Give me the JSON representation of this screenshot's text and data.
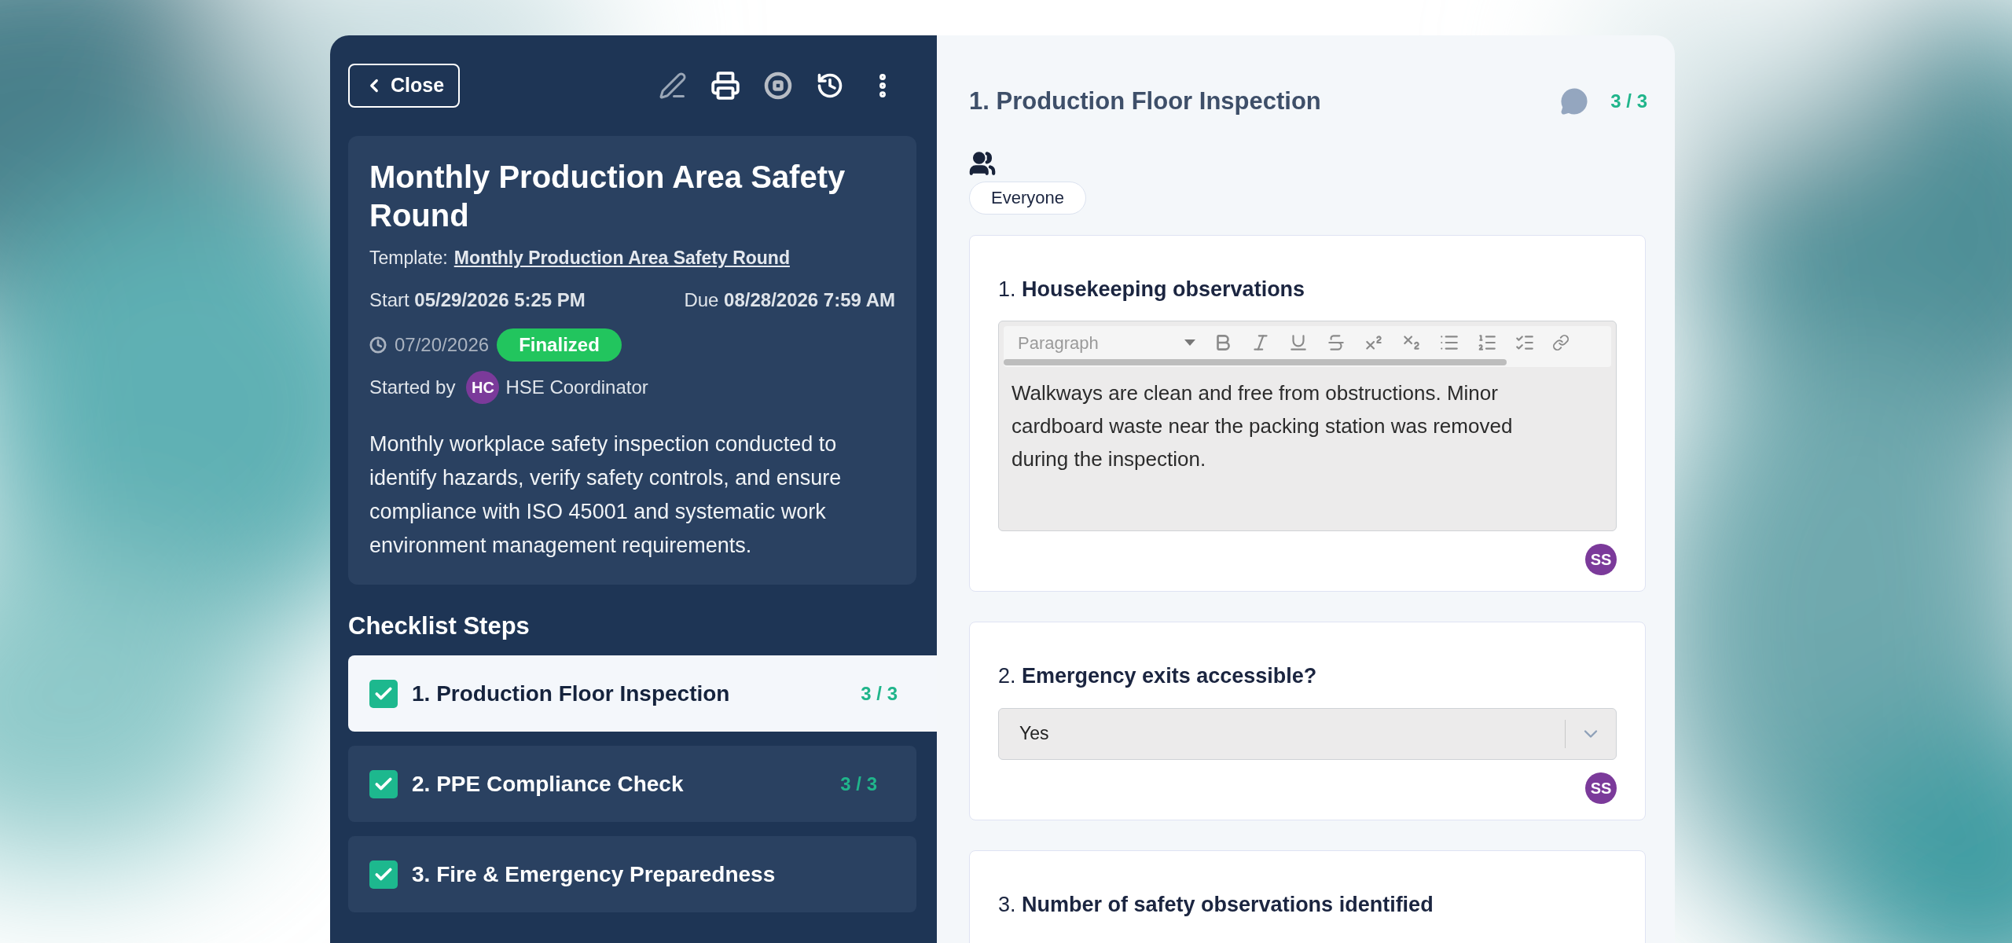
{
  "toolbar": {
    "close_label": "Close"
  },
  "header": {
    "title": "Monthly Production Area Safety Round",
    "template_label": "Template:",
    "template_link": "Monthly Production Area Safety Round",
    "start": "Start **05/29/2026 5:25 PM**",
    "due": "Due **08/28/2026 7:59 AM**",
    "date": "07/20/2026",
    "status": "Finalized",
    "started_by_label": "Started by",
    "starter_initials": "HC",
    "starter_name": "HSE Coordinator",
    "description": "Monthly workplace safety inspection conducted to identify hazards, verify safety controls, and ensure compliance with ISO 45001 and systematic work environment management requirements."
  },
  "steps_heading": "Checklist Steps",
  "steps": [
    {
      "label": "1. Production Floor Inspection",
      "count": "3 / 3",
      "checked": true,
      "selected": true
    },
    {
      "label": "2. PPE Compliance Check",
      "count": "3 / 3",
      "checked": true,
      "selected": false
    },
    {
      "label": "3. Fire & Emergency Preparedness",
      "checked": true,
      "selected": false
    }
  ],
  "section": {
    "title": "1. Production Floor Inspection",
    "count": "3 / 3",
    "audience": "Everyone"
  },
  "questions": [
    {
      "kind": "text",
      "label": "1. **Housekeeping observations**",
      "format": "Paragraph",
      "value": "Walkways are clean and free from obstructions. Minor cardboard waste near the packing station was removed during the inspection.",
      "initials": "SS"
    },
    {
      "kind": "select",
      "label": "2. **Emergency exits accessible?**",
      "value": "Yes",
      "initials": "SS"
    },
    {
      "kind": "number",
      "label": "3. **Number of safety observations identified**"
    }
  ]
}
